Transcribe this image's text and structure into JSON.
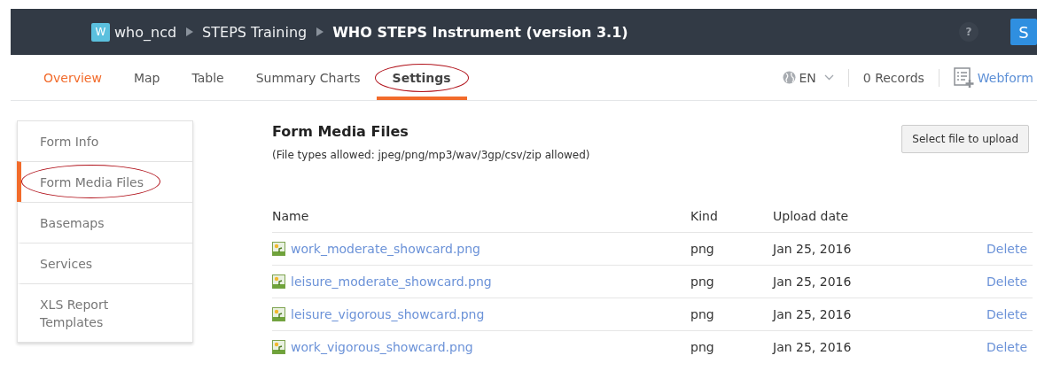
{
  "header": {
    "breadcrumb": [
      {
        "label": "who_ncd",
        "avatar": "W",
        "current": false
      },
      {
        "label": "STEPS Training",
        "current": false
      },
      {
        "label": "WHO STEPS Instrument (version 3.1)",
        "current": true
      }
    ],
    "help": "?",
    "user_avatar": "S"
  },
  "tabs": [
    {
      "label": "Overview",
      "selected": false,
      "accent": true,
      "circled": false
    },
    {
      "label": "Map",
      "selected": false,
      "accent": false,
      "circled": false
    },
    {
      "label": "Table",
      "selected": false,
      "accent": false,
      "circled": false
    },
    {
      "label": "Summary Charts",
      "selected": false,
      "accent": false,
      "circled": false
    },
    {
      "label": "Settings",
      "selected": true,
      "accent": false,
      "circled": true
    }
  ],
  "toolbar": {
    "language": "EN",
    "records": "0 Records",
    "webform": "Webform"
  },
  "sidebar": {
    "items": [
      {
        "label": "Form Info",
        "selected": false,
        "circled": false
      },
      {
        "label": "Form Media Files",
        "selected": true,
        "circled": true
      },
      {
        "label": "Basemaps",
        "selected": false,
        "circled": false
      },
      {
        "label": "Services",
        "selected": false,
        "circled": false
      },
      {
        "label": "XLS Report Templates",
        "selected": false,
        "circled": false
      }
    ]
  },
  "content": {
    "title": "Form Media Files",
    "note": "(File types allowed: jpeg/png/mp3/wav/3gp/csv/zip allowed)",
    "upload_button": "Select file to upload",
    "table": {
      "columns": [
        "Name",
        "Kind",
        "Upload date"
      ],
      "rows": [
        {
          "name": "work_moderate_showcard.png",
          "kind": "png",
          "date": "Jan 25, 2016",
          "action": "Delete"
        },
        {
          "name": "leisure_moderate_showcard.png",
          "kind": "png",
          "date": "Jan 25, 2016",
          "action": "Delete"
        },
        {
          "name": "leisure_vigorous_showcard.png",
          "kind": "png",
          "date": "Jan 25, 2016",
          "action": "Delete"
        },
        {
          "name": "work_vigorous_showcard.png",
          "kind": "png",
          "date": "Jan 25, 2016",
          "action": "Delete"
        }
      ]
    }
  }
}
